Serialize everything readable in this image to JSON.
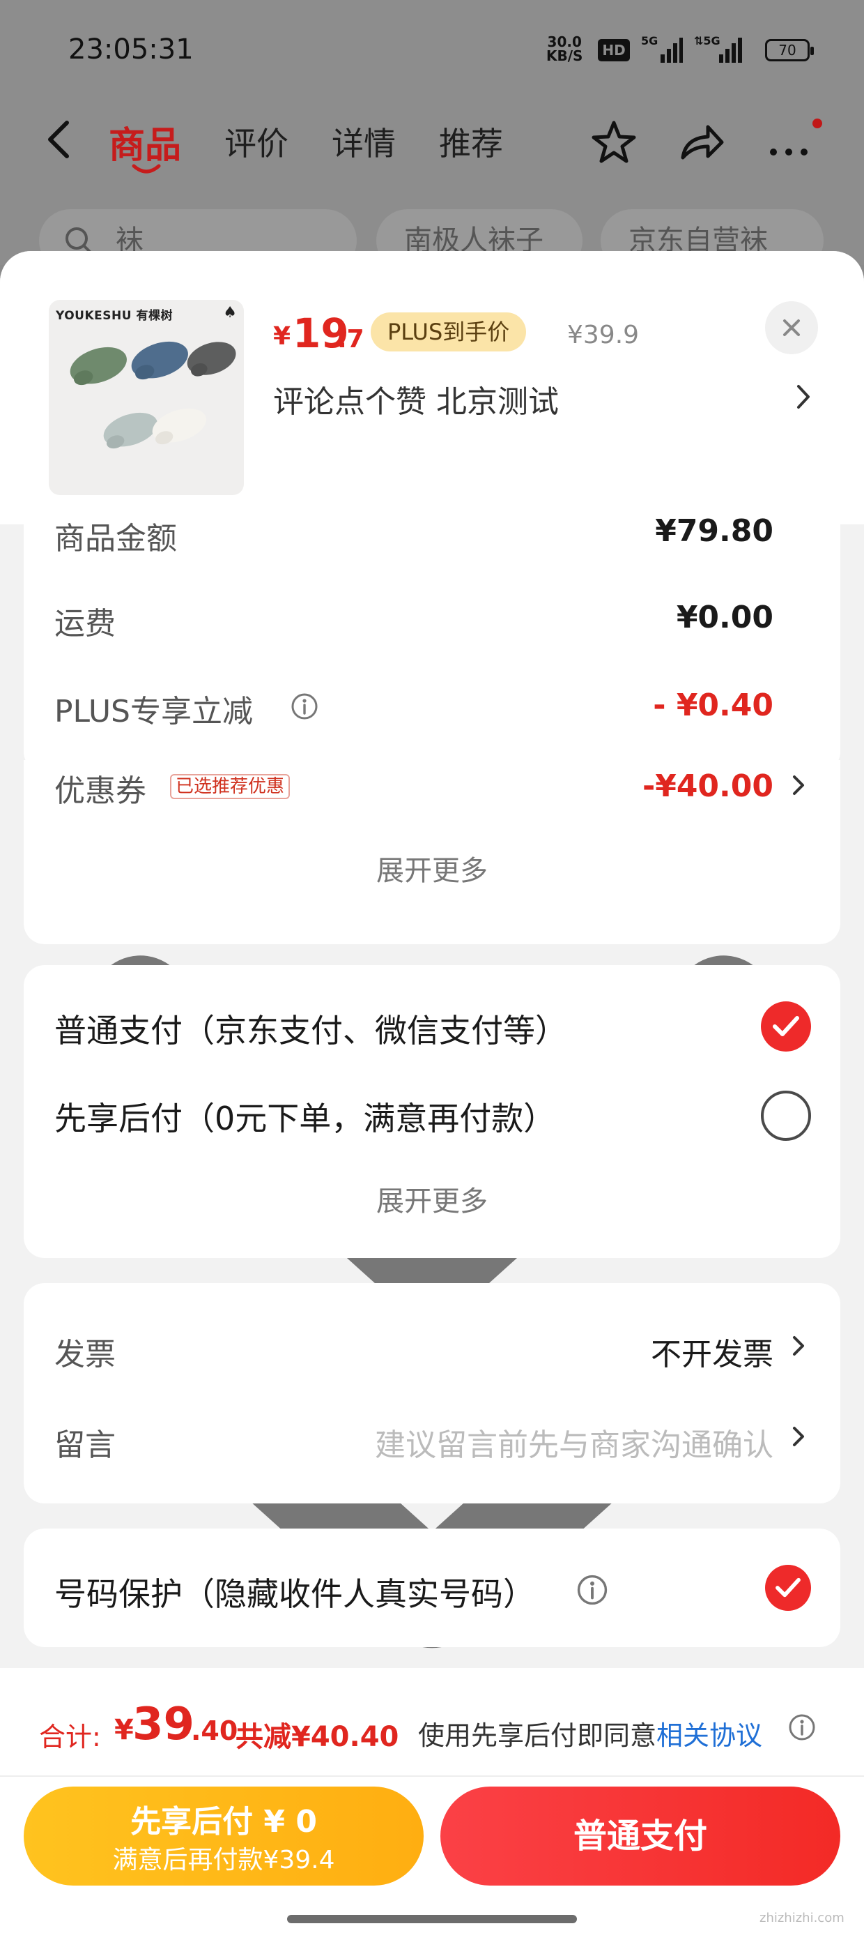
{
  "status_bar": {
    "time": "23:05:31",
    "net_speed": "30.0",
    "net_unit": "KB/S",
    "hd_label": "HD",
    "battery": "70"
  },
  "nav": {
    "tabs": [
      "商品",
      "评价",
      "详情",
      "推荐"
    ],
    "active_tab": "商品"
  },
  "background_chips": [
    "袜",
    "南极人袜子",
    "京东自营袜"
  ],
  "product": {
    "brand_text": "YOUKESHU 有棵树",
    "price_symbol": "¥",
    "price_int": "19",
    "price_dec": ".7",
    "plus_label": "PLUS到手价",
    "original_price": "¥39.9",
    "spec": "评论点个赞  北京测试"
  },
  "summary": {
    "rows": [
      {
        "label": "商品金额",
        "value": "¥79.80"
      },
      {
        "label": "运费",
        "value": "¥0.00"
      },
      {
        "label": "PLUS专享立减",
        "value": "- ¥0.40"
      },
      {
        "label": "优惠券",
        "value": "-¥40.00",
        "tag": "已选推荐优惠"
      }
    ],
    "expand_label": "展开更多"
  },
  "payment": {
    "options": [
      {
        "label": "普通支付（京东支付、微信支付等）",
        "selected": true
      },
      {
        "label": "先享后付（0元下单，满意再付款）",
        "selected": false
      }
    ],
    "expand_label": "展开更多"
  },
  "extras": {
    "invoice_label": "发票",
    "invoice_value": "不开发票",
    "message_label": "留言",
    "message_placeholder": "建议留言前先与商家沟通确认"
  },
  "privacy": {
    "label": "号码保护（隐藏收件人真实号码）",
    "enabled": true
  },
  "footer": {
    "total_label": "合计:",
    "total_symbol": "¥",
    "total_int": "39",
    "total_dec": ".40",
    "total_saved": "共减¥40.40",
    "agree_text": "使用先享后付即同意",
    "agree_link": "相关协议",
    "bnpl_line1": "先享后付 ¥ 0",
    "bnpl_line2": "满意后再付款¥39.4",
    "pay_button": "普通支付"
  },
  "watermark": "zhizhizhi.com",
  "colors": {
    "accent_red": "#e0261f",
    "plus_gold": "#fbe4a8",
    "bnpl_yellow": "#ffb81a",
    "link_blue": "#1f6fd6"
  }
}
